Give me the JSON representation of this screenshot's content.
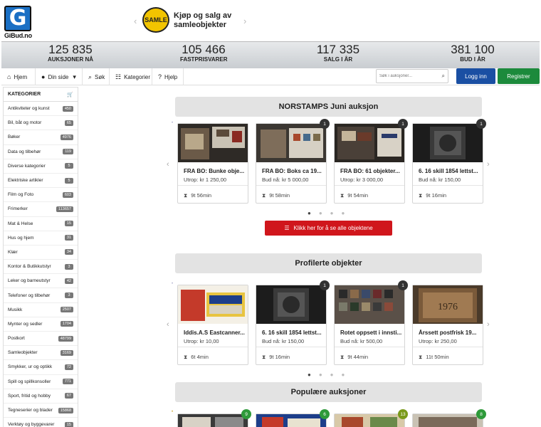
{
  "site": {
    "logo_letter": "G",
    "logo_text": "GiBud.no"
  },
  "promo": {
    "badge_text": "SAMLE",
    "text": "Kjøp og salg av samleobjekter",
    "prev": "‹",
    "next": "›"
  },
  "stats": [
    {
      "value": "125 835",
      "label": "AUKSJONER NÅ"
    },
    {
      "value": "105 466",
      "label": "FASTPRISVARER"
    },
    {
      "value": "117 335",
      "label": "SALG I ÅR"
    },
    {
      "value": "381 100",
      "label": "BUD I ÅR"
    }
  ],
  "nav": {
    "home": "Hjem",
    "my_page": "Din side",
    "search": "Søk",
    "categories": "Kategorier",
    "help": "Hjelp",
    "search_placeholder": "Søk i auksjoner...",
    "login": "Logg inn",
    "register": "Registrer"
  },
  "sidebar": {
    "title": "KATEGORIER",
    "items": [
      {
        "label": "Antikviteter og kunst",
        "count": "450"
      },
      {
        "label": "Bil, båt og motor",
        "count": "65"
      },
      {
        "label": "Bøker",
        "count": "4976"
      },
      {
        "label": "Data og tilbehør",
        "count": "119"
      },
      {
        "label": "Diverse kategorier",
        "count": "5"
      },
      {
        "label": "Elektriske artikler",
        "count": "5"
      },
      {
        "label": "Film og Foto",
        "count": "603"
      },
      {
        "label": "Frimerker",
        "count": "113657"
      },
      {
        "label": "Mat & Helse",
        "count": "15"
      },
      {
        "label": "Hus og hjem",
        "count": "31"
      },
      {
        "label": "Klær",
        "count": "34"
      },
      {
        "label": "Kontor & Butikkutstyr",
        "count": "3"
      },
      {
        "label": "Leker og barneutstyr",
        "count": "42"
      },
      {
        "label": "Telefoner og tilbehør",
        "count": "3"
      },
      {
        "label": "Musikk",
        "count": "2507"
      },
      {
        "label": "Mynter og sedler",
        "count": "1704"
      },
      {
        "label": "Postkort",
        "count": "48799"
      },
      {
        "label": "Samleobjekter",
        "count": "3169"
      },
      {
        "label": "Smykker, ur og optikk",
        "count": "72"
      },
      {
        "label": "Spill og spillkonsoller",
        "count": "771"
      },
      {
        "label": "Sport, fritid og hobby",
        "count": "67"
      },
      {
        "label": "Tegneserier og blader",
        "count": "15868"
      },
      {
        "label": "Verktøy og byggevarer",
        "count": "15"
      }
    ]
  },
  "sections": {
    "norstamps": {
      "title": "NORSTAMPS Juni auksjon",
      "cta": "Klikk her for å se alle objektene",
      "items": [
        {
          "title": "FRA BO: Bunke obje...",
          "price": "Utrop: kr 1 250,00",
          "time": "9t 56min",
          "badge": ""
        },
        {
          "title": "FRA BO: Boks ca 19...",
          "price": "Bud nå: kr 5 000,00",
          "time": "9t 58min",
          "badge": "1"
        },
        {
          "title": "FRA BO: 61 objekter...",
          "price": "Utrop: kr 3 000,00",
          "time": "9t 54min",
          "badge": "1"
        },
        {
          "title": "6. 16 skill 1854 lettst...",
          "price": "Bud nå: kr 150,00",
          "time": "9t 16min",
          "badge": "1"
        }
      ]
    },
    "featured": {
      "title": "Profilerte objekter",
      "items": [
        {
          "title": "Iddis.A.S Eastcanner...",
          "price": "Utrop: kr 10,00",
          "time": "6t 4min",
          "badge": ""
        },
        {
          "title": "6. 16 skill 1854 lettst...",
          "price": "Bud nå: kr 150,00",
          "time": "9t 16min",
          "badge": "1"
        },
        {
          "title": "Rotet oppsett i innsti...",
          "price": "Bud nå: kr 500,00",
          "time": "9t 44min",
          "badge": "1"
        },
        {
          "title": "Årssett postfrisk 19...",
          "price": "Utrop: kr 250,00",
          "time": "11t 50min",
          "badge": ""
        }
      ]
    },
    "popular": {
      "title": "Populære auksjoner",
      "badges": [
        "9",
        "6",
        "13",
        "8"
      ]
    }
  },
  "colors": {
    "login": "#1a4fa3",
    "register": "#1c8a3c",
    "cta": "#d0161c",
    "count_badge": "#777777"
  },
  "icons": {
    "home": "home-icon",
    "user": "user-icon",
    "search": "search-icon",
    "categories": "sitemap-icon",
    "help": "question-icon",
    "cart": "cart-icon",
    "timer": "hourglass-icon",
    "list": "list-icon"
  }
}
